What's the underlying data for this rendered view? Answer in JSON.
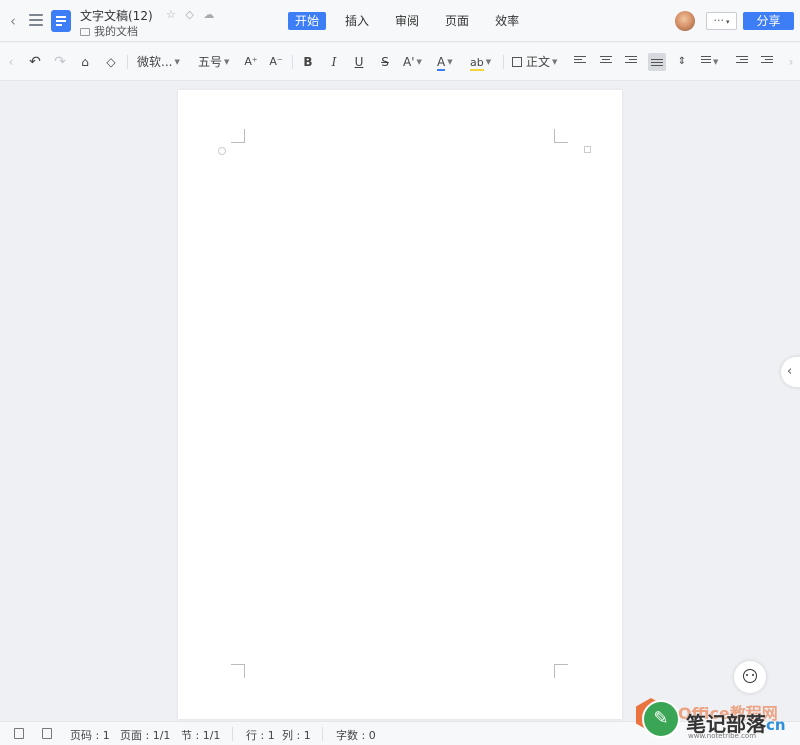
{
  "titlebar": {
    "doc_title": "文字文稿(12)",
    "folder": "我的文档",
    "title_icons": [
      "☆",
      "◇",
      "☁"
    ],
    "tabs": [
      {
        "label": "开始",
        "active": true
      },
      {
        "label": "插入",
        "active": false
      },
      {
        "label": "审阅",
        "active": false
      },
      {
        "label": "页面",
        "active": false
      },
      {
        "label": "效率",
        "active": false
      }
    ],
    "more_label": "···",
    "share_label": "分享"
  },
  "toolbar": {
    "font_name": "微软...",
    "font_size": "五号",
    "font_grow": "A⁺",
    "font_shrink": "A⁻",
    "bold": "B",
    "italic": "I",
    "underline": "U",
    "strike": "S",
    "font_effect": "A'",
    "font_color": "A",
    "highlight": "ab",
    "style_name": "正文",
    "accent_color": "#3d7df5",
    "highlight_color": "#f5d33d"
  },
  "statusbar": {
    "page_num": "页码 : 1",
    "page_total": "页面 : 1/1",
    "section": "节 : 1/1",
    "row": "行 : 1",
    "col": "列 : 1",
    "word_count": "字数 : 0"
  },
  "watermark": {
    "brand_top": "Office教程网",
    "brand_cn": "笔记部落",
    "brand_suffix": "cn",
    "url": "www.notetribe.com"
  }
}
